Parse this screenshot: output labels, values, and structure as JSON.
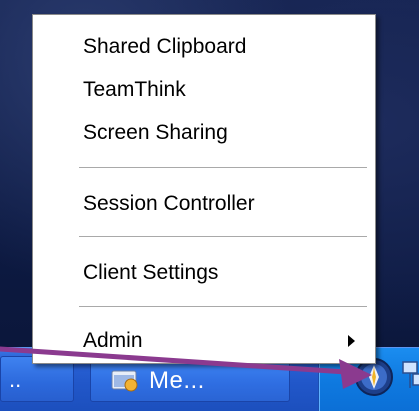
{
  "taskbar": {
    "left_button_text": "..",
    "me_button_label": "Me..."
  },
  "tray": {
    "app_icon": "teamthink-tray-icon",
    "network_icon": "network-connection-icon"
  },
  "menu": {
    "items": [
      {
        "label": "Shared Clipboard"
      },
      {
        "label": "TeamThink"
      },
      {
        "label": "Screen Sharing"
      },
      {
        "label": "Session Controller"
      },
      {
        "label": "Client Settings"
      },
      {
        "label": "Admin",
        "has_submenu": true
      }
    ]
  },
  "callout": {
    "color": "#8b3a8f"
  }
}
